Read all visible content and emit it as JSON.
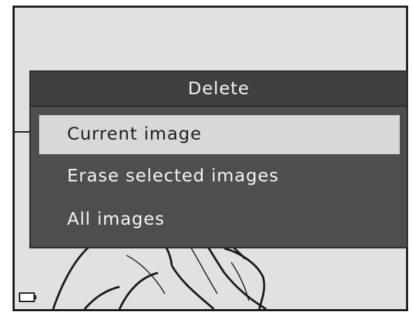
{
  "dialog": {
    "title": "Delete",
    "items": [
      {
        "label": "Current image",
        "selected": true
      },
      {
        "label": "Erase selected images",
        "selected": false
      },
      {
        "label": "All images",
        "selected": false
      }
    ]
  },
  "icons": {
    "battery": "battery-icon"
  },
  "colors": {
    "dialog_background": "#4e4e4e",
    "dialog_header": "#3f3f3f",
    "selected_item": "#d8d8d8",
    "screen_background": "#e1e1e1"
  }
}
